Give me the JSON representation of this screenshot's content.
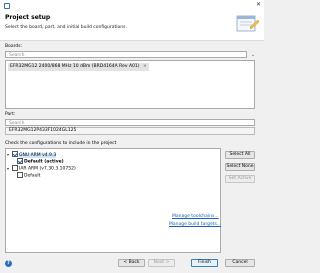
{
  "header": {
    "title": "Project setup",
    "description": "Select the board, part, and initial build configurations."
  },
  "boards": {
    "label": "Boards:",
    "search_placeholder": "Search",
    "selected_board": "EFR32MG12 2400/868 MHz 10 dBm (BRD4164A Rev A01)"
  },
  "part": {
    "label": "Part:",
    "search_placeholder": "Search",
    "value": "EFR32MG12P433F1024GL125"
  },
  "configurations": {
    "label": "Check the configurations to include in the project",
    "tree": [
      {
        "name": "GNU ARM v4.9.3",
        "children": [
          "Default (active)"
        ]
      },
      {
        "name": "IAR ARM (v7.30.3.10752)",
        "children": [
          "Default"
        ]
      }
    ],
    "buttons": {
      "select_all": "Select All",
      "select_none": "Select None",
      "set_active": "Set Active"
    }
  },
  "links": {
    "manage_toolchains": "Manage toolchains...",
    "manage_build_targets": "Manage build targets..."
  },
  "footer": {
    "help": "?",
    "back": "< Back",
    "next": "Next >",
    "finish": "Finish",
    "cancel": "Cancel"
  }
}
